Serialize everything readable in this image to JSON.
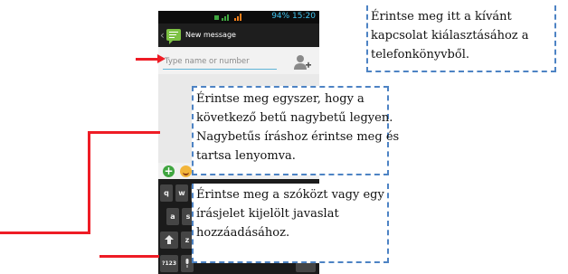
{
  "status_bar": {
    "text": "94% 15:20"
  },
  "title_bar": {
    "title": "New message"
  },
  "recipient": {
    "placeholder": "Type name or number"
  },
  "keyboard": {
    "top_row": [
      "q",
      "w"
    ],
    "middle_row": [
      "a",
      "s"
    ],
    "bottom_row": [
      "z"
    ],
    "symbols_key": "?123"
  },
  "callouts": {
    "contacts": [
      "Érintse meg itt a kívánt",
      "kapcsolat kiálasztásához a",
      "telefonkönyvből."
    ],
    "capitalize": [
      "Érintse meg egyszer, hogy a",
      "következő betű nagybetű legyen.",
      "Nagybetűs íráshoz érintse meg és",
      "tartsa lenyomva."
    ],
    "suggestion": [
      "Érintse meg a szóközt vagy egy",
      "írásjelet kijelölt javaslat",
      "hozzáadásához."
    ]
  },
  "colors": {
    "callout_border": "#4d83c4",
    "pointer": "#ee1c25",
    "app_icon": "#7dc243",
    "status_accent": "#3fc2ee"
  }
}
